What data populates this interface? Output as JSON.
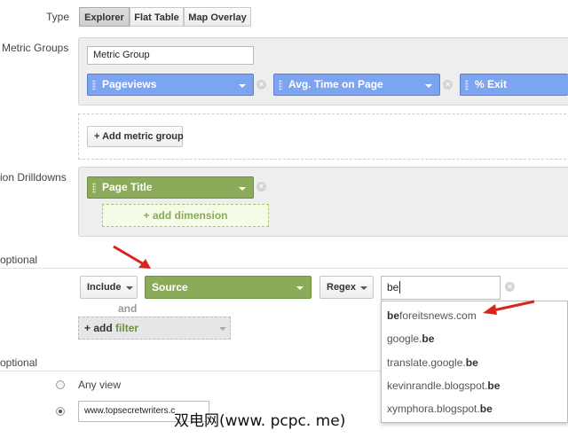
{
  "type_row": {
    "label": "Type",
    "options": [
      "Explorer",
      "Flat Table",
      "Map Overlay"
    ],
    "selected": "Explorer"
  },
  "metric_groups": {
    "label": "Metric Groups",
    "group_name_value": "Metric Group",
    "metrics": [
      "Pageviews",
      "Avg. Time on Page",
      "% Exit"
    ],
    "add_button": "+ Add metric group"
  },
  "dimension_drilldowns": {
    "label": "ion Drilldowns",
    "dimension": "Page Title",
    "add_dimension": "+ add dimension"
  },
  "filters": {
    "section_label": "optional",
    "include_select": "Include",
    "dimension": "Source",
    "match_select": "Regex",
    "input_value": "be",
    "and_text": "and",
    "add_filter_prefix": "+ add",
    "add_filter_word": "filter"
  },
  "autocomplete": [
    {
      "prefix": "be",
      "rest": "foreitsnews.com"
    },
    {
      "prefix": "google.",
      "match": "be"
    },
    {
      "prefix": "translate.google.",
      "match": "be"
    },
    {
      "prefix": "kevinrandle.blogspot.",
      "match": "be"
    },
    {
      "prefix": "xymphora.blogspot.",
      "match": "be"
    }
  ],
  "views": {
    "section_label": "optional",
    "any_view": "Any view",
    "selected_view_value": "www.topsecretwriters.c"
  },
  "watermark": "双电网(www. pcpc. me)",
  "colors": {
    "metric_blue": "#7da4f0",
    "dimension_green": "#8cab5a",
    "arrow_red": "#d9241c"
  }
}
